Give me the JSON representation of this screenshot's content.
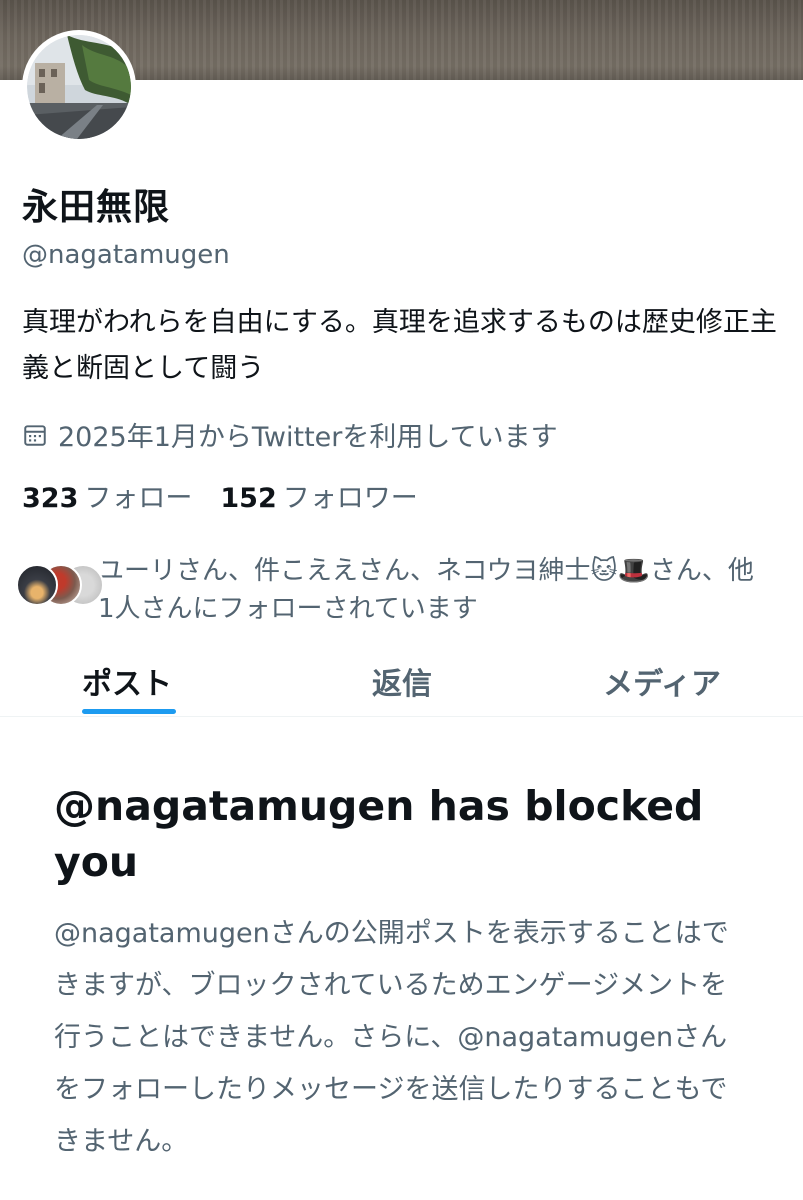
{
  "profile": {
    "display_name": "永田無限",
    "handle": "@nagatamugen",
    "bio": "真理がわれらを自由にする。真理を追求するものは歴史修正主義と断固として闘う",
    "joined": "2025年1月からTwitterを利用しています",
    "following_count": "323",
    "following_label": "フォロー",
    "followers_count": "152",
    "followers_label": "フォロワー",
    "followed_by_text": "ユーリさん、件こええさん、ネコウヨ紳士🐱🎩さん、他1人さんにフォローされています"
  },
  "tabs": [
    {
      "label": "ポスト",
      "active": true
    },
    {
      "label": "返信",
      "active": false
    },
    {
      "label": "メディア",
      "active": false
    }
  ],
  "blocked": {
    "title": "@nagatamugen has blocked you",
    "body": "@nagatamugenさんの公開ポストを表示することはできますが、ブロックされているためエンゲージメントを行うことはできません。さらに、@nagatamugenさんをフォローしたりメッセージを送信したりすることもできません。"
  },
  "icons": {
    "calendar": "calendar-icon"
  },
  "colors": {
    "accent": "#1d9bf0",
    "text_primary": "#0f1419",
    "text_secondary": "#536471"
  }
}
